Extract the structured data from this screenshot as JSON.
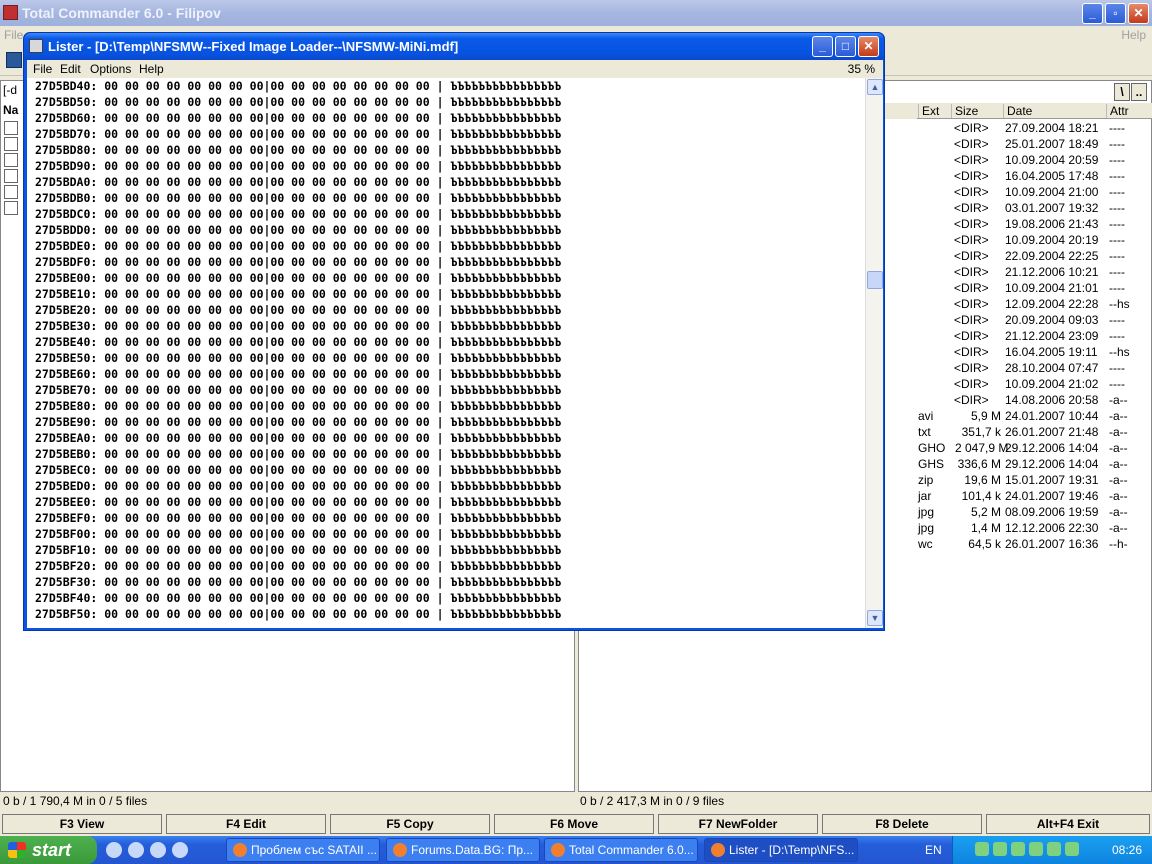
{
  "main_window": {
    "title": "Total Commander 6.0 - Filipov",
    "menu_left": "File",
    "menu_right": "Help"
  },
  "left_panel": {
    "drive": "[-d",
    "header": "Na",
    "status": "0 b / 1 790,4 M in 0 / 5 files"
  },
  "right_panel": {
    "path_buttons": [
      "\\",
      ".."
    ],
    "columns": {
      "ext": "Ext",
      "size": "Size",
      "date": "Date",
      "attr": "Attr"
    },
    "rows": [
      {
        "ext": "",
        "size": "<DIR>",
        "date": "27.09.2004 18:21",
        "attr": "----"
      },
      {
        "ext": "",
        "size": "<DIR>",
        "date": "25.01.2007 18:49",
        "attr": "----"
      },
      {
        "ext": "",
        "size": "<DIR>",
        "date": "10.09.2004 20:59",
        "attr": "----"
      },
      {
        "ext": "",
        "size": "<DIR>",
        "date": "16.04.2005 17:48",
        "attr": "----"
      },
      {
        "ext": "",
        "size": "<DIR>",
        "date": "10.09.2004 21:00",
        "attr": "----"
      },
      {
        "ext": "",
        "size": "<DIR>",
        "date": "03.01.2007 19:32",
        "attr": "----"
      },
      {
        "ext": "",
        "size": "<DIR>",
        "date": "19.08.2006 21:43",
        "attr": "----"
      },
      {
        "ext": "",
        "size": "<DIR>",
        "date": "10.09.2004 20:19",
        "attr": "----"
      },
      {
        "ext": "",
        "size": "<DIR>",
        "date": "22.09.2004 22:25",
        "attr": "----"
      },
      {
        "ext": "",
        "size": "<DIR>",
        "date": "21.12.2006 10:21",
        "attr": "----"
      },
      {
        "ext": "",
        "size": "<DIR>",
        "date": "10.09.2004 21:01",
        "attr": "----"
      },
      {
        "ext": "",
        "size": "<DIR>",
        "date": "12.09.2004 22:28",
        "attr": "--hs"
      },
      {
        "ext": "",
        "size": "<DIR>",
        "date": "20.09.2004 09:03",
        "attr": "----"
      },
      {
        "ext": "",
        "size": "<DIR>",
        "date": "21.12.2004 23:09",
        "attr": "----"
      },
      {
        "ext": "",
        "size": "<DIR>",
        "date": "16.04.2005 19:11",
        "attr": "--hs"
      },
      {
        "ext": "",
        "size": "<DIR>",
        "date": "28.10.2004 07:47",
        "attr": "----"
      },
      {
        "ext": "",
        "size": "<DIR>",
        "date": "10.09.2004 21:02",
        "attr": "----"
      },
      {
        "ext": "",
        "size": "<DIR>",
        "date": "14.08.2006 20:58",
        "attr": "-a--"
      },
      {
        "ext": "avi",
        "size": "5,9 M",
        "date": "24.01.2007 10:44",
        "attr": "-a--"
      },
      {
        "ext": "txt",
        "size": "351,7 k",
        "date": "26.01.2007 21:48",
        "attr": "-a--"
      },
      {
        "ext": "GHO",
        "size": "2 047,9 M",
        "date": "29.12.2006 14:04",
        "attr": "-a--"
      },
      {
        "ext": "GHS",
        "size": "336,6 M",
        "date": "29.12.2006 14:04",
        "attr": "-a--"
      },
      {
        "ext": "zip",
        "size": "19,6 M",
        "date": "15.01.2007 19:31",
        "attr": "-a--"
      },
      {
        "ext": "jar",
        "size": "101,4 k",
        "date": "24.01.2007 19:46",
        "attr": "-a--"
      },
      {
        "ext": "jpg",
        "size": "5,2 M",
        "date": "08.09.2006 19:59",
        "attr": "-a--"
      },
      {
        "ext": "jpg",
        "size": "1,4 M",
        "date": "12.12.2006 22:30",
        "attr": "-a--"
      },
      {
        "ext": "wc",
        "size": "64,5 k",
        "date": "26.01.2007 16:36",
        "attr": "--h-"
      }
    ],
    "status": "0 b / 2 417,3 M in 0 / 9 files"
  },
  "function_keys": [
    "F3 View",
    "F4 Edit",
    "F5 Copy",
    "F6 Move",
    "F7 NewFolder",
    "F8 Delete",
    "Alt+F4 Exit"
  ],
  "lister": {
    "title": "Lister - [D:\\Temp\\NFSMW--Fixed Image Loader--\\NFSMW-MiNi.mdf]",
    "menu": [
      "File",
      "Edit",
      "Options",
      "Help"
    ],
    "percent": "35 %",
    "hex_bytes": "00 00 00 00 00 00 00 00|00 00 00 00 00 00 00 00",
    "hex_ascii": "ЪЪЪЪЪЪЪЪЪЪЪЪЪЪЪЪ",
    "offsets": [
      "27D5BD40",
      "27D5BD50",
      "27D5BD60",
      "27D5BD70",
      "27D5BD80",
      "27D5BD90",
      "27D5BDA0",
      "27D5BDB0",
      "27D5BDC0",
      "27D5BDD0",
      "27D5BDE0",
      "27D5BDF0",
      "27D5BE00",
      "27D5BE10",
      "27D5BE20",
      "27D5BE30",
      "27D5BE40",
      "27D5BE50",
      "27D5BE60",
      "27D5BE70",
      "27D5BE80",
      "27D5BE90",
      "27D5BEA0",
      "27D5BEB0",
      "27D5BEC0",
      "27D5BED0",
      "27D5BEE0",
      "27D5BEF0",
      "27D5BF00",
      "27D5BF10",
      "27D5BF20",
      "27D5BF30",
      "27D5BF40",
      "27D5BF50"
    ]
  },
  "taskbar": {
    "start_label": "start",
    "tasks": [
      "Проблем със SATAII ...",
      "Forums.Data.BG: Пр...",
      "Total Commander 6.0...",
      "Lister - [D:\\Temp\\NFS..."
    ],
    "language": "EN",
    "clock": "08:26"
  },
  "colors": {
    "xp_blue": "#0a54e3",
    "taskbar_blue": "#245edb",
    "start_green": "#3a9a3a",
    "panel_bg": "#ece9d8"
  }
}
